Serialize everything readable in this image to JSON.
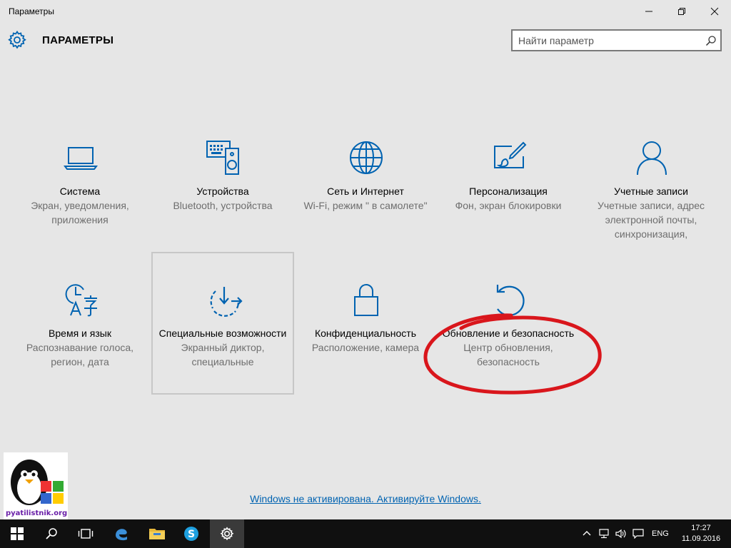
{
  "window": {
    "title": "Параметры",
    "minimize": "minimize",
    "maximize": "restore",
    "close": "close"
  },
  "header": {
    "heading": "ПАРАМЕТРЫ"
  },
  "search": {
    "placeholder": "Найти параметр",
    "value": ""
  },
  "tiles": [
    {
      "icon": "laptop-icon",
      "name": "Система",
      "desc": "Экран, уведомления, приложения"
    },
    {
      "icon": "devices-icon",
      "name": "Устройства",
      "desc": "Bluetooth, устройства"
    },
    {
      "icon": "globe-icon",
      "name": "Сеть и Интернет",
      "desc": "Wi-Fi, режим \" в самолете\""
    },
    {
      "icon": "personalization-icon",
      "name": "Персонализация",
      "desc": "Фон, экран блокировки"
    },
    {
      "icon": "person-icon",
      "name": "Учетные записи",
      "desc": "Учетные записи, адрес электронной почты, синхронизация,"
    },
    {
      "icon": "time-language-icon",
      "name": "Время и язык",
      "desc": "Распознавание голоса, регион, дата"
    },
    {
      "icon": "accessibility-icon",
      "name": "Специальные возможности",
      "desc": "Экранный диктор, специальные"
    },
    {
      "icon": "lock-icon",
      "name": "Конфиденциальность",
      "desc": "Расположение, камера"
    },
    {
      "icon": "update-icon",
      "name": "Обновление и безопасность",
      "desc": "Центр обновления, безопасность"
    }
  ],
  "activation": {
    "text": "Windows не активирована. Активируйте Windows."
  },
  "watermark": {
    "text": "pyatilistnik.org"
  },
  "taskbar": {
    "lang": "ENG",
    "time": "17:27",
    "date": "11.09.2016"
  },
  "colors": {
    "accent": "#0063b1",
    "background": "#e6e6e6",
    "taskbar": "#101010",
    "highlight": "#d9161c"
  }
}
